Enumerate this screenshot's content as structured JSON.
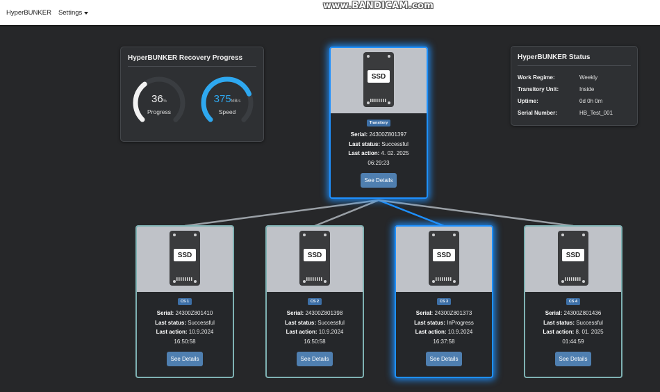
{
  "navbar": {
    "brand": "HyperBUNKER",
    "settings": "Settings"
  },
  "watermark": "www.BANDICAM.com",
  "recovery": {
    "title": "HyperBUNKER Recovery Progress",
    "progress": {
      "value": "36",
      "unit": "%",
      "label": "Progress",
      "fraction": 0.36
    },
    "speed": {
      "value": "375",
      "unit": "MB/s",
      "label": "Speed",
      "fraction": 0.75
    }
  },
  "status": {
    "title": "HyperBUNKER Status",
    "rows": [
      {
        "key": "Work Regime:",
        "value": "Weekly"
      },
      {
        "key": "Transitory Unit:",
        "value": "Inside"
      },
      {
        "key": "Uptime:",
        "value": "0d 0h 0m"
      },
      {
        "key": "Serial Number:",
        "value": "HB_Test_001"
      }
    ]
  },
  "labels": {
    "ssd": "SSD",
    "serial": "Serial:",
    "last_status": "Last status:",
    "last_action": "Last action:",
    "see_details": "See Details"
  },
  "transitory": {
    "badge": "Transitory",
    "serial": "24300Z801397",
    "status": "Successful",
    "action_date": "4. 02. 2025",
    "action_time": "06:29:23"
  },
  "units": [
    {
      "badge": "CS 1",
      "serial": "24300Z801410",
      "status": "Successful",
      "action_date": "10.9.2024",
      "action_time": "16:50:58"
    },
    {
      "badge": "CS 2",
      "serial": "24300Z801398",
      "status": "Successful",
      "action_date": "10.9.2024",
      "action_time": "16:50:58"
    },
    {
      "badge": "CS 3",
      "serial": "24300Z801373",
      "status": "InProgress",
      "action_date": "10.9.2024",
      "action_time": "16:37:58"
    },
    {
      "badge": "CS 4",
      "serial": "24300Z801436",
      "status": "Successful",
      "action_date": "8. 01. 2025",
      "action_time": "01:44:59"
    }
  ],
  "colors": {
    "accent": "#1e90ff",
    "connector_idle": "#9aa0a6",
    "connector_active": "#1e90ff",
    "card_border": "#7fb2b3",
    "button": "#4f7fb0",
    "badge": "#3d6fa6"
  },
  "active_unit": "CS 3"
}
